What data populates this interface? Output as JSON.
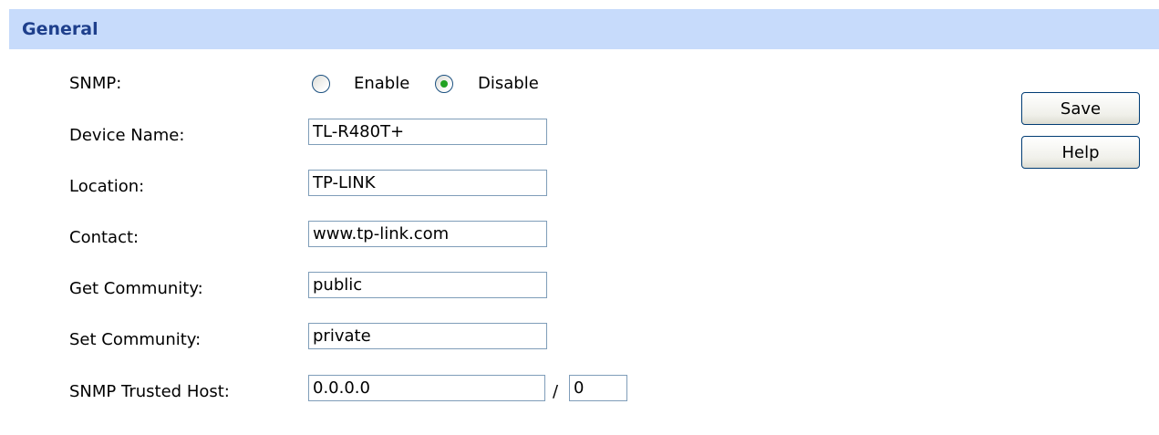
{
  "section": {
    "title": "General"
  },
  "snmp": {
    "label": "SNMP:",
    "options": [
      "Enable",
      "Disable"
    ],
    "selected": "Disable"
  },
  "fields": {
    "device_name": {
      "label": "Device Name:",
      "value": "TL-R480T+"
    },
    "location": {
      "label": "Location:",
      "value": "TP-LINK"
    },
    "contact": {
      "label": "Contact:",
      "value": "www.tp-link.com"
    },
    "get_community": {
      "label": "Get Community:",
      "value": "public"
    },
    "set_community": {
      "label": "Set Community:",
      "value": "private"
    },
    "trusted_host": {
      "label": "SNMP Trusted Host:",
      "ip": "0.0.0.0",
      "separator": "/",
      "mask": "0"
    }
  },
  "buttons": {
    "save": "Save",
    "help": "Help"
  },
  "colors": {
    "header_background": "#c7dbfb",
    "header_text": "#1e3f8c",
    "input_border": "#7f9db9",
    "radio_selected": "#21a121"
  }
}
